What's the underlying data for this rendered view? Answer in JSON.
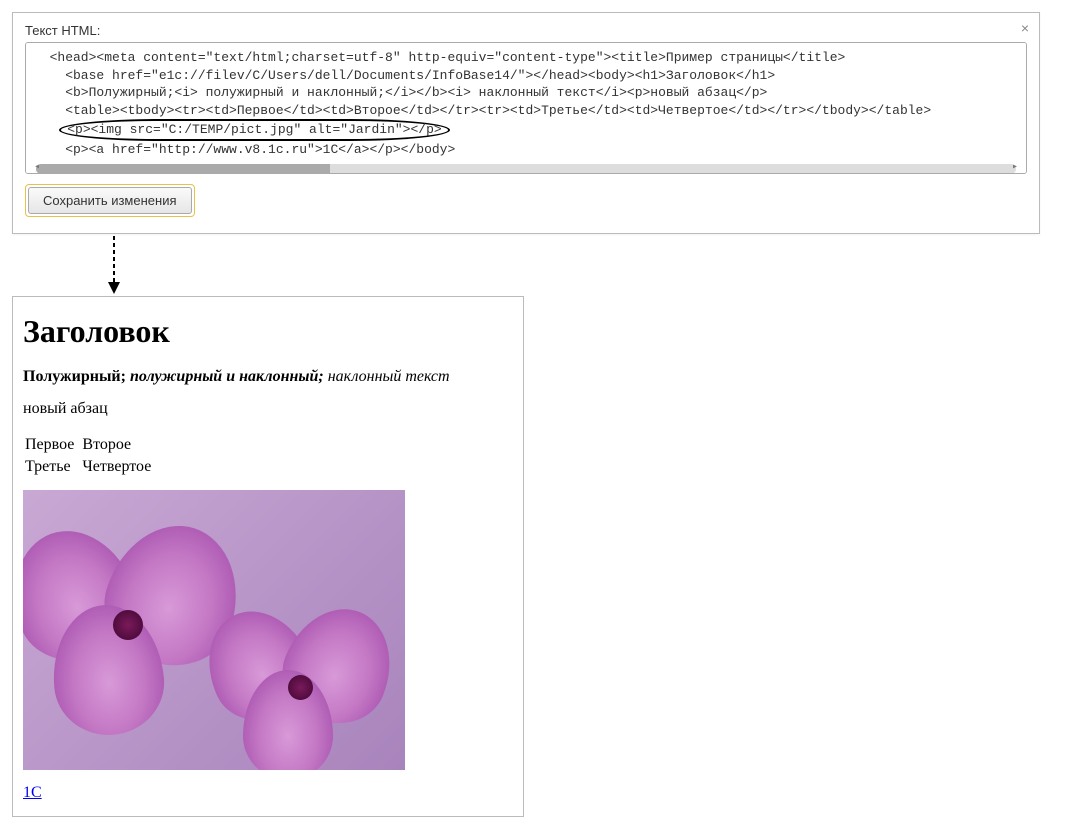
{
  "editor": {
    "label": "Текст HTML:",
    "close": "×",
    "code": {
      "line1": "  <head><meta content=\"text/html;charset=utf-8\" http-equiv=\"content-type\"><title>Пример страницы</title>",
      "line2": "    <base href=\"e1c://filev/C/Users/dell/Documents/InfoBase14/\"></head><body><h1>Заголовок</h1>",
      "line3": "    <b>Полужирный;<i> полужирный и наклонный;</i></b><i> наклонный текст</i><p>новый абзац</p>",
      "line4": "    <table><tbody><tr><td>Первое</td><td>Второе</td></tr><tr><td>Третье</td><td>Четвертое</td></tr></tbody></table>",
      "line5": "<p><img src=\"C:/TEMP/pict.jpg\" alt=\"Jardin\"></p>",
      "line6": "    <p><a href=\"http://www.v8.1c.ru\">1C</a></p></body>"
    },
    "save_button": "Сохранить изменения"
  },
  "preview": {
    "heading": "Заголовок",
    "bold": "Полужирный; ",
    "bold_italic": "полужирный и наклонный; ",
    "italic": "наклонный текст",
    "paragraph": "новый абзац",
    "table": {
      "r1c1": "Первое",
      "r1c2": "Второе",
      "r2c1": "Третье",
      "r2c2": "Четвертое"
    },
    "image_alt": "Jardin",
    "link_text": "1C",
    "link_href": "http://www.v8.1c.ru"
  }
}
